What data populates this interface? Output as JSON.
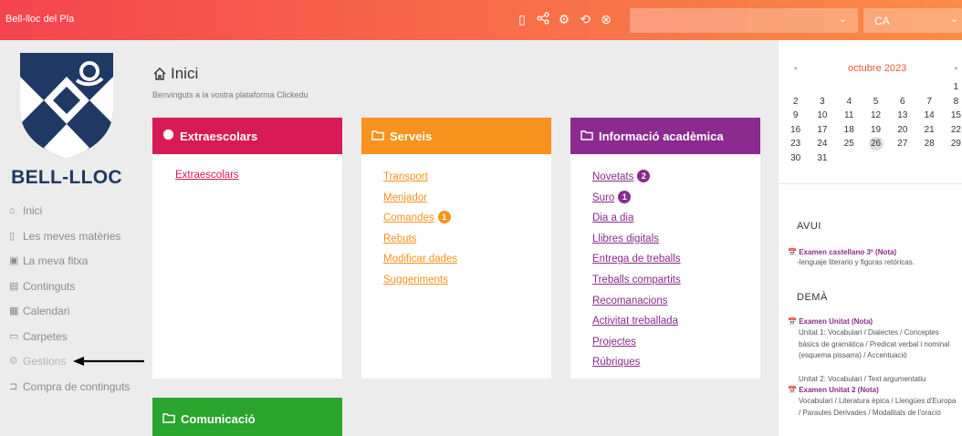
{
  "topbar": {
    "brand": "Bell-lloc del Pla",
    "icons": [
      "tablet-icon",
      "share-icon",
      "settings-icon",
      "refresh-icon",
      "close-circle-icon"
    ],
    "language": "CA"
  },
  "sidebar": {
    "logo_text": "BELL-LLOC",
    "items": [
      {
        "icon": "⌂",
        "label": "Inici"
      },
      {
        "icon": "▯",
        "label": "Les meves matèries"
      },
      {
        "icon": "▣",
        "label": "La meva fitxa"
      },
      {
        "icon": "▤",
        "label": "Continguts"
      },
      {
        "icon": "▦",
        "label": "Calendari"
      },
      {
        "icon": "▭",
        "label": "Carpetes"
      },
      {
        "icon": "⚙",
        "label": "Gestions"
      },
      {
        "icon": "⊐",
        "label": "Compra de continguts"
      }
    ]
  },
  "main": {
    "title": "Inici",
    "subtitle": "Benvinguts a la vostra plataforma Clickedu",
    "cards": {
      "extraescolars": {
        "title": "Extraescolars",
        "color": "#d81b56",
        "links": [
          {
            "label": "Extraescolars",
            "badge": ""
          }
        ]
      },
      "serveis": {
        "title": "Serveis",
        "color": "#f7931e",
        "links": [
          {
            "label": "Transport",
            "badge": ""
          },
          {
            "label": "Menjador",
            "badge": ""
          },
          {
            "label": "Comandes",
            "badge": "1"
          },
          {
            "label": "Rebuts",
            "badge": ""
          },
          {
            "label": "Modificar dades",
            "badge": ""
          },
          {
            "label": "Suggeriments",
            "badge": ""
          }
        ]
      },
      "academica": {
        "title": "Informació acadèmica",
        "color": "#8b2a8f",
        "links": [
          {
            "label": "Novetats",
            "badge": "2"
          },
          {
            "label": "Suro",
            "badge": "1"
          },
          {
            "label": "Dia a dia",
            "badge": ""
          },
          {
            "label": "Llibres digitals",
            "badge": ""
          },
          {
            "label": "Entrega de treballs",
            "badge": ""
          },
          {
            "label": "Treballs compartits",
            "badge": ""
          },
          {
            "label": "Recomanacions",
            "badge": ""
          },
          {
            "label": "Activitat treballada",
            "badge": ""
          },
          {
            "label": "Projectes",
            "badge": ""
          },
          {
            "label": "Rúbriques",
            "badge": ""
          }
        ]
      },
      "comunicacio": {
        "title": "Comunicació",
        "color": "#2aa52e"
      }
    }
  },
  "calendar": {
    "month": "octubre 2023",
    "prev": "◂",
    "next": "▸",
    "weeks": [
      [
        "",
        "",
        "",
        "",
        "",
        "",
        "1"
      ],
      [
        "2",
        "3",
        "4",
        "5",
        "6",
        "7",
        "8"
      ],
      [
        "9",
        "10",
        "11",
        "12",
        "13",
        "14",
        "15"
      ],
      [
        "16",
        "17",
        "18",
        "19",
        "20",
        "21",
        "22"
      ],
      [
        "23",
        "24",
        "25",
        "26",
        "27",
        "28",
        "29"
      ],
      [
        "30",
        "31",
        "",
        "",
        "",
        "",
        ""
      ]
    ],
    "today": "26"
  },
  "agenda": {
    "today_label": "AVUI",
    "today_events": [
      {
        "title": "Examen castellano 3º (Nota)",
        "desc": "-lenguaje literario y figuras retóricas."
      }
    ],
    "tomorrow_label": "DEMÀ",
    "tomorrow_events": [
      {
        "title": "Examen Unitat (Nota)",
        "desc": "Unitat 1: Vocabulari / Dialectes / Conceptes bàsics de gramàtica / Predicat verbal i nominal (esquema pissarra) / Accentuació"
      },
      {
        "title": "Examen Unitat 2 (Nota)",
        "desc": "Vocabulari / Literatura èpica / Llengües d'Europa / Paraules Derivades / Modalitats de l'oració"
      }
    ],
    "between_text": "Unitat 2: Vocabulari / Text argumentatiu"
  }
}
